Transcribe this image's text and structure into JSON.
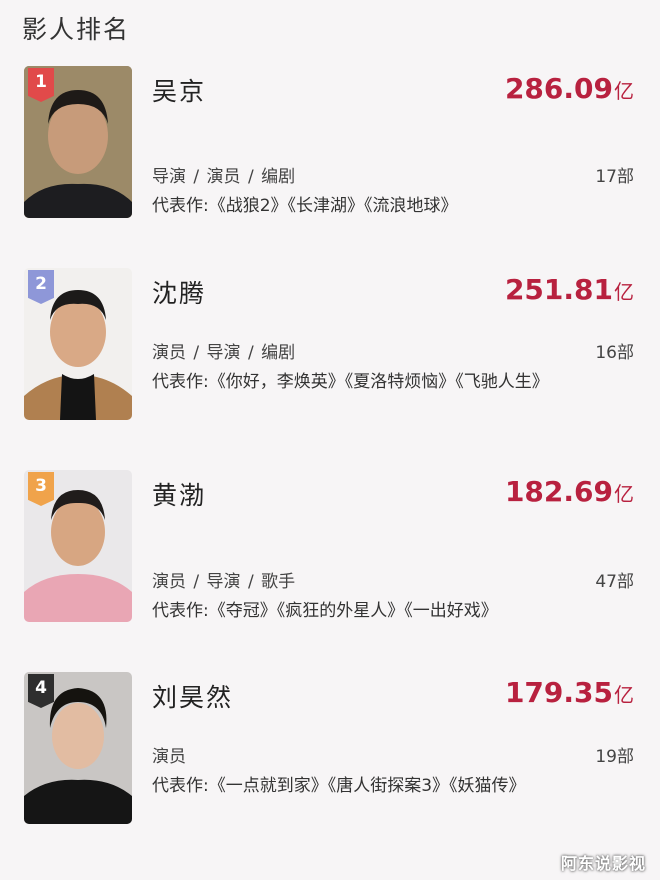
{
  "page": {
    "title": "影人排名"
  },
  "colors": {
    "accent": "#b8213f",
    "rank1": "#e14a4a",
    "rank2": "#8e97d8",
    "rank3": "#f0a34b",
    "rank4": "#2e2e2e"
  },
  "rankings": [
    {
      "rank": "1",
      "name": "吴京",
      "boxoffice": "286.09",
      "unit": "亿",
      "roles": "导演 / 演员 / 编剧",
      "count": "17部",
      "works": "代表作:《战狼2》《长津湖》《流浪地球》"
    },
    {
      "rank": "2",
      "name": "沈腾",
      "boxoffice": "251.81",
      "unit": "亿",
      "roles": "演员 / 导演 / 编剧",
      "count": "16部",
      "works": "代表作:《你好，李焕英》《夏洛特烦恼》《飞驰人生》"
    },
    {
      "rank": "3",
      "name": "黄渤",
      "boxoffice": "182.69",
      "unit": "亿",
      "roles": "演员 / 导演 / 歌手",
      "count": "47部",
      "works": "代表作:《夺冠》《疯狂的外星人》《一出好戏》"
    },
    {
      "rank": "4",
      "name": "刘昊然",
      "boxoffice": "179.35",
      "unit": "亿",
      "roles": "演员",
      "count": "19部",
      "works": "代表作:《一点就到家》《唐人街探案3》《妖猫传》"
    }
  ],
  "watermark": "阿东说影视"
}
